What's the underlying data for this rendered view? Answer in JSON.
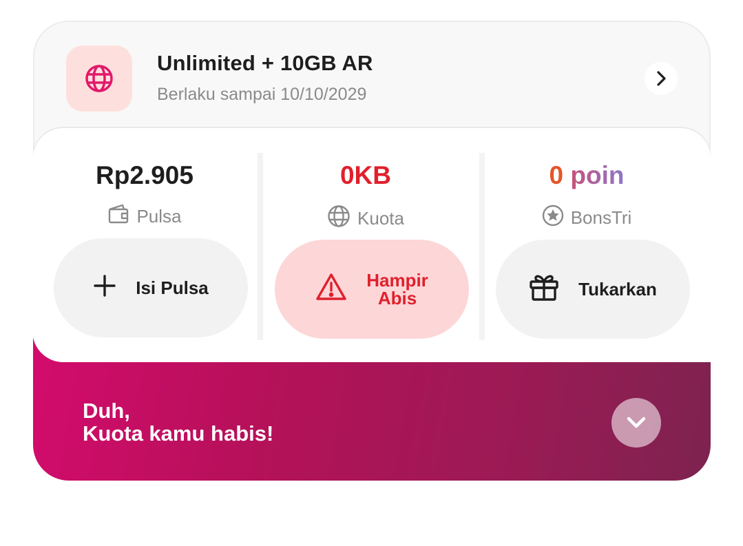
{
  "plan": {
    "title": "Unlimited + 10GB AR",
    "validity": "Berlaku sampai 10/10/2029",
    "icon": "globe-icon"
  },
  "balances": {
    "pulsa": {
      "value": "Rp2.905",
      "label": "Pulsa",
      "icon": "wallet-icon",
      "action_label": "Isi Pulsa",
      "action_icon": "plus-icon"
    },
    "kuota": {
      "value": "0KB",
      "label": "Kuota",
      "icon": "globe-icon",
      "action_line1": "Hampir",
      "action_line2": "Abis",
      "action_icon": "warning-icon"
    },
    "bonstri": {
      "value_number": "0",
      "value_word": "poin",
      "label": "BonsTri",
      "icon": "star-badge-icon",
      "action_label": "Tukarkan",
      "action_icon": "gift-icon"
    }
  },
  "banner": {
    "line1": "Duh,",
    "line2": "Kuota kamu habis!",
    "expand_icon": "chevron-down-icon"
  },
  "colors": {
    "brand_pink": "#d40b6d",
    "alert_red": "#e0202c",
    "alert_bg": "#fdd6d8",
    "icon_bg": "#fde0dd"
  }
}
